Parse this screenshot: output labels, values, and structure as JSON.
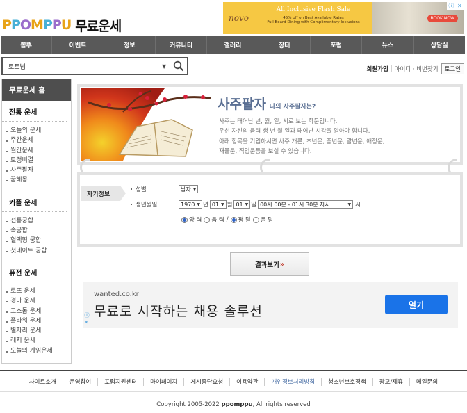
{
  "header": {
    "logo": "PPOMPPU",
    "section_title": "무료운세"
  },
  "ad_top": {
    "brand": "novo",
    "headline": "All Inclusive Flash Sale",
    "line1": "45% off on Best Available Rates",
    "line2": "Full Board Dining with Complimentary Inclusions",
    "cta": "BOOK NOW"
  },
  "nav": {
    "items": [
      "뽐뿌",
      "이벤트",
      "정보",
      "커뮤니티",
      "갤러리",
      "장터",
      "포럼",
      "뉴스",
      "상담실"
    ]
  },
  "search": {
    "value": "토트넘"
  },
  "auth": {
    "join": "회원가입",
    "find": "아이디 · 비번찾기",
    "login": "로그인"
  },
  "sidebar": {
    "home": "무료운세 홈",
    "groups": [
      {
        "title": "전통 운세",
        "items": [
          "오늘의 운세",
          "주간운세",
          "월간운세",
          "토정비결",
          "사주팔자",
          "꿈해몽"
        ]
      },
      {
        "title": "커플 운세",
        "items": [
          "전통궁합",
          "속궁합",
          "혈액형 궁합",
          "첫데이트 궁합"
        ]
      },
      {
        "title": "퓨전 운세",
        "items": [
          "로또 운세",
          "경마 운세",
          "고스톱 운세",
          "플라워 운세",
          "별자리 운세",
          "레저 운세",
          "오늘의 게임운세"
        ]
      }
    ]
  },
  "hero": {
    "title": "사주팔자",
    "subtitle": "나의 사주팔자는?",
    "desc": [
      "사주는 태어난 년, 월, 일, 시로 보는 학문입니다.",
      "우선 자신의 음력 생 년 월 일과 태어난 시각을 알아야 합니다.",
      "아래 항목을 기입하시면 사주 개론, 초년운, 중년운, 말년운, 애정운,",
      "재물운, 직업운등을 보실 수 있습니다."
    ]
  },
  "form": {
    "tab": "자기정보",
    "gender_label": "성별",
    "gender_value": "남자",
    "birth_label": "생년월일",
    "year": "1970",
    "year_unit": "년",
    "month": "01",
    "month_unit": "월",
    "day": "01",
    "day_unit": "일",
    "time": "00시:00분 - 01시:30분 자시",
    "time_unit": "시",
    "cal_solar": "양 력",
    "cal_lunar": "음 력",
    "slash": "/",
    "month_normal": "평 달",
    "month_leap": "윤 달"
  },
  "submit": {
    "label": "결과보기",
    "arrow": "»"
  },
  "ad_bottom": {
    "domain": "wanted.co.kr",
    "headline": "무료로 시작하는 채용 솔루션",
    "cta": "열기"
  },
  "footer": {
    "links": [
      "사이트소개",
      "운영참여",
      "포럼지원센터",
      "마이페이지",
      "게시중단요청",
      "이용약관",
      "개인정보처리방침",
      "청소년보호정책",
      "광고/제휴",
      "메일문의"
    ],
    "copyright_prefix": "Copyright 2005-2022",
    "copyright_brand": "ppomppu",
    "copyright_suffix": ", All rights reserved"
  }
}
